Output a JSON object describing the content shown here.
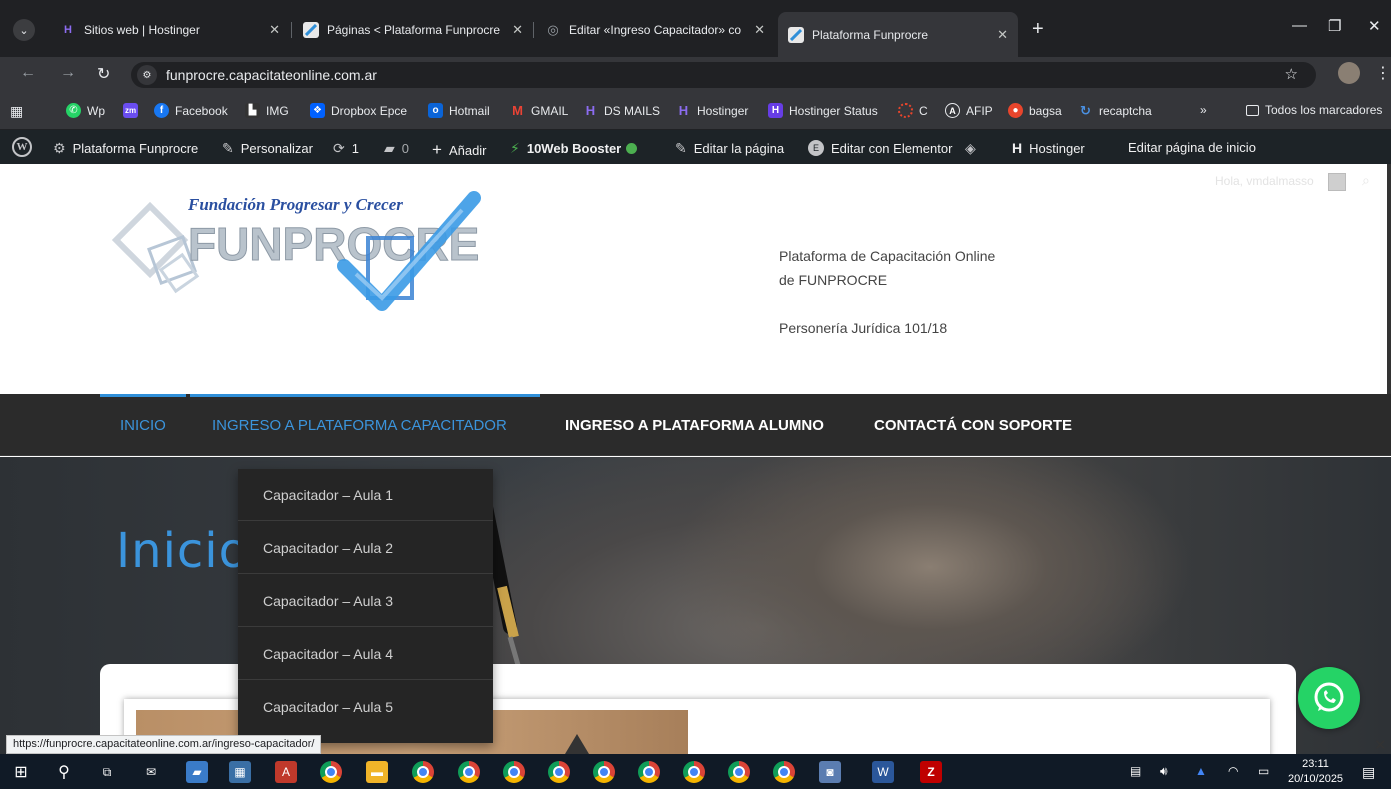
{
  "browser": {
    "tabs": [
      {
        "title": "Sitios web | Hostinger",
        "favicon": "hostinger-icon"
      },
      {
        "title": "Páginas < Plataforma Funprocre",
        "favicon": "site-icon"
      },
      {
        "title": "Editar «Ingreso Capacitador» co",
        "favicon": "globe-icon"
      },
      {
        "title": "Plataforma Funprocre",
        "favicon": "site-icon",
        "active": true
      }
    ],
    "url": "funprocre.capacitateonline.com.ar",
    "bookmarks": [
      "Wp",
      "Facebook",
      "IMG",
      "Dropbox Epce",
      "Hotmail",
      "GMAIL",
      "DS MAILS",
      "Hostinger",
      "Hostinger Status",
      "C",
      "AFIP",
      "bagsa",
      "recaptcha"
    ],
    "bookmarks_overflow": "»",
    "all_bookmarks": "Todos los marcadores",
    "zm_label": "zm"
  },
  "adminbar": {
    "site_name": "Plataforma Funprocre",
    "customize": "Personalizar",
    "updates": "1",
    "comments": "0",
    "add_new": "Añadir",
    "booster": "10Web Booster",
    "edit_page": "Editar la página",
    "edit_elementor": "Editar con Elementor",
    "hostinger": "Hostinger",
    "edit_home": "Editar página de inicio"
  },
  "header": {
    "greeting": "Hola, vmdalmasso",
    "logo_line1": "Fundación Progresar y Crecer",
    "logo_line2": "FUNPROCRE",
    "tagline_1": "Plataforma de Capacitación Online",
    "tagline_2": "de FUNPROCRE",
    "tagline_3": "Personería Jurídica 101/18"
  },
  "nav": {
    "items": [
      "INICIO",
      "INGRESO A PLATAFORMA CAPACITADOR",
      "INGRESO A PLATAFORMA ALUMNO",
      "CONTACTÁ CON SOPORTE"
    ],
    "accent_color": "#2f8fd8"
  },
  "dropdown": {
    "items": [
      "Capacitador – Aula 1",
      "Capacitador – Aula 2",
      "Capacitador – Aula 3",
      "Capacitador – Aula 4",
      "Capacitador – Aula 5"
    ]
  },
  "hero": {
    "title": "Inicio"
  },
  "status_bar_url": "https://funprocre.capacitateonline.com.ar/ingreso-capacitador/",
  "taskbar": {
    "time": "23:11",
    "date": "20/10/2025"
  },
  "colors": {
    "link_blue": "#3b94dc",
    "whatsapp_green": "#25d366",
    "admin_bar": "#1d2327"
  }
}
